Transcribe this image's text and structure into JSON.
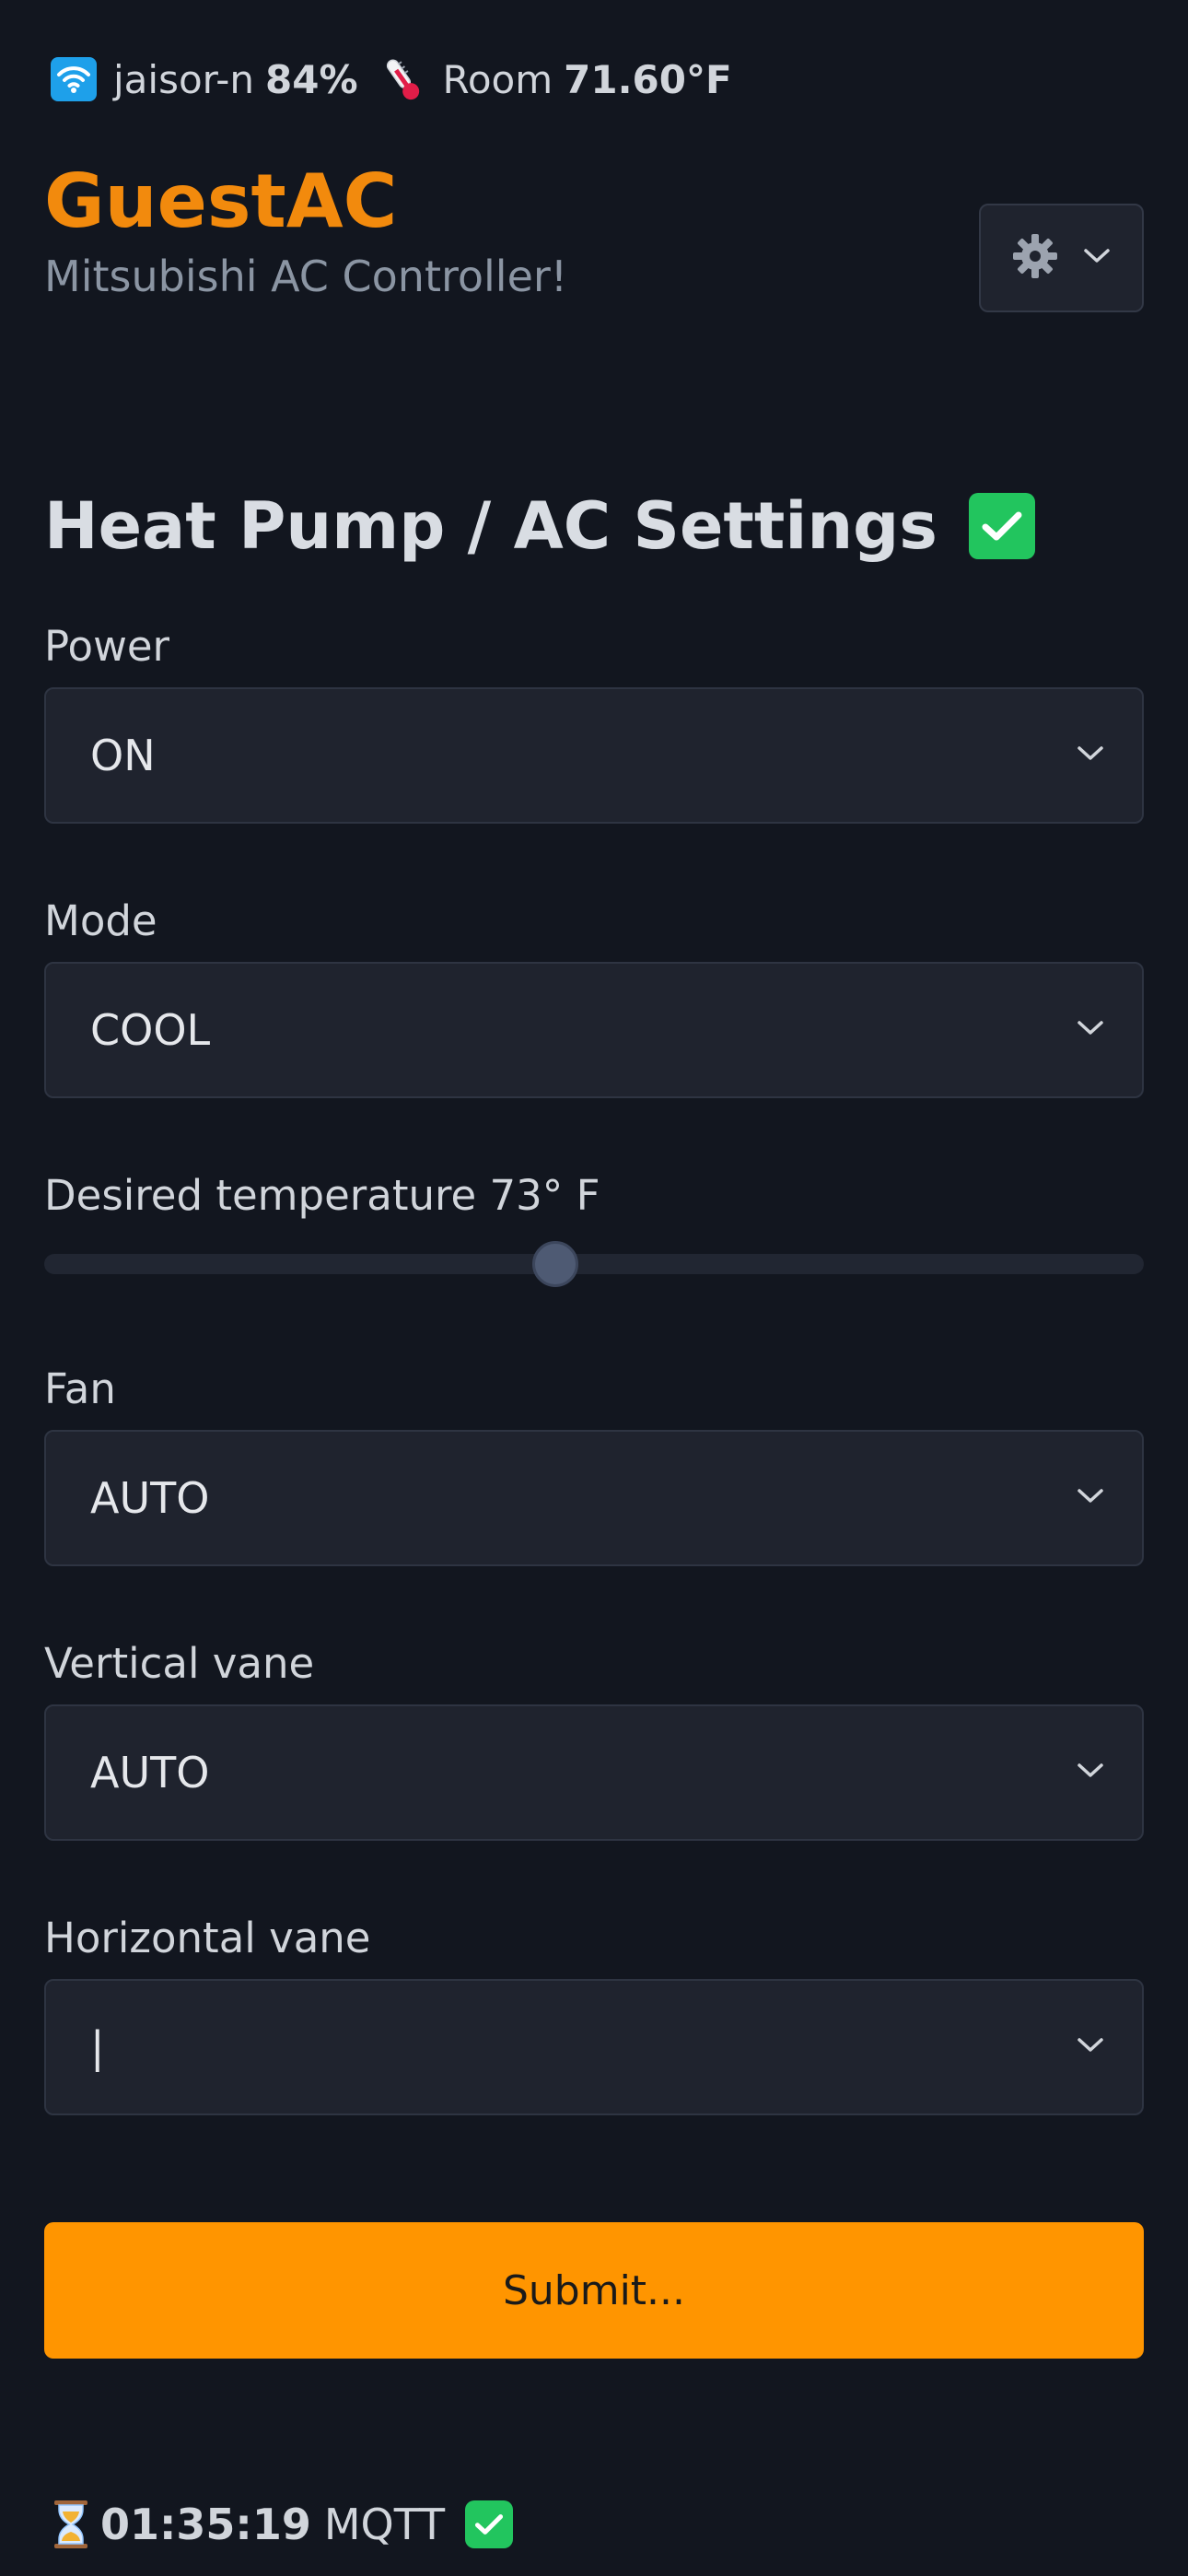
{
  "status": {
    "wifi_icon": "wifi-icon",
    "ssid": "jaisor-n",
    "signal": "84%",
    "thermo_icon": "thermometer-icon",
    "room_label": "Room",
    "room_temp": "71.60°F"
  },
  "header": {
    "title": "GuestAC",
    "subtitle": "Mitsubishi AC Controller!",
    "settings_icon": "gear-icon"
  },
  "section": {
    "title": "Heat Pump / AC Settings",
    "status_icon": "check-icon"
  },
  "fields": {
    "power": {
      "label": "Power",
      "value": "ON"
    },
    "mode": {
      "label": "Mode",
      "value": "COOL"
    },
    "temperature": {
      "label": "Desired temperature 73° F",
      "value": 73,
      "slider_fraction": 0.465
    },
    "fan": {
      "label": "Fan",
      "value": "AUTO"
    },
    "vertical_vane": {
      "label": "Vertical vane",
      "value": "AUTO"
    },
    "horizontal_vane": {
      "label": "Horizontal vane",
      "value": "|"
    }
  },
  "submit_label": "Submit...",
  "footer": {
    "hourglass_icon": "hourglass-icon",
    "uptime": "01:35:19",
    "mqtt_label": "MQTT",
    "mqtt_status_icon": "check-icon"
  },
  "colors": {
    "background": "#12161f",
    "brand": "#f28a0d",
    "submit": "#ff9500",
    "success": "#22c55e",
    "wifi": "#1ea0ea"
  }
}
